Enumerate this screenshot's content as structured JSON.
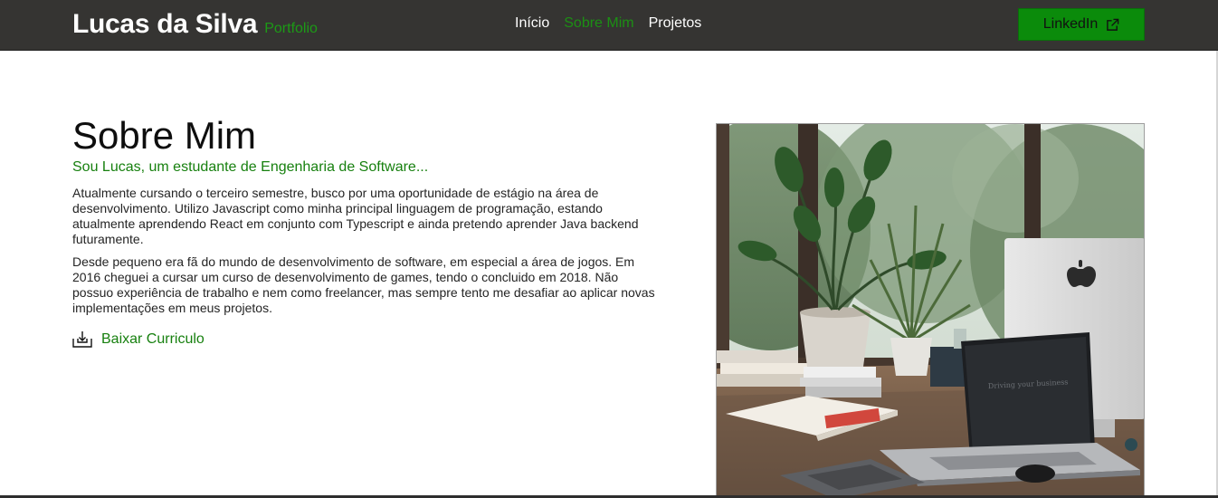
{
  "header": {
    "brand_name": "Lucas da Silva",
    "brand_tag": "Portfolio",
    "nav": [
      {
        "label": "Início",
        "active": false
      },
      {
        "label": "Sobre Mim",
        "active": true
      },
      {
        "label": "Projetos",
        "active": false
      }
    ],
    "linkedin_label": "LinkedIn",
    "linkedin_icon": "external-link-icon"
  },
  "about": {
    "title": "Sobre Mim",
    "subtitle": "Sou Lucas, um estudante de Engenharia de Software...",
    "paragraph_1": "Atualmente cursando o terceiro semestre, busco por uma oportunidade de estágio na área de desenvolvimento. Utilizo Javascript como minha principal linguagem de programação, estando atualmente aprendendo React em conjunto com Typescript e ainda pretendo aprender Java backend futuramente.",
    "paragraph_2": "Desde pequeno era fã do mundo de desenvolvimento de software, em especial a área de jogos. Em 2016 cheguei a cursar um curso de desenvolvimento de games, tendo o concluido em 2018. Não possuo experiência de trabalho e nem como freelancer, mas sempre tento me desafiar ao aplicar novas implementações em meus projetos.",
    "download_label": "Baixar Curriculo",
    "download_icon": "download-icon"
  },
  "photo": {
    "laptop_screen_text": "Driving your business"
  },
  "colors": {
    "accent_green": "#1c8f14",
    "button_green": "#0b8b0b",
    "header_bg": "#353432"
  }
}
